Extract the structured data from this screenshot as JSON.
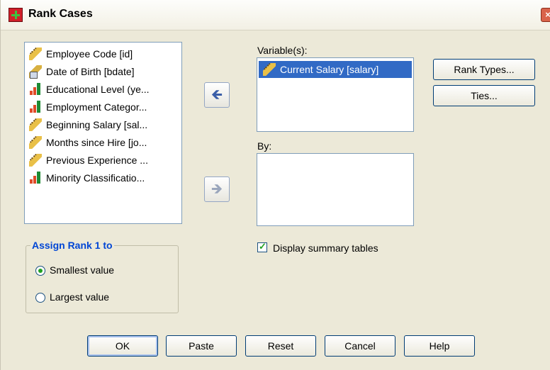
{
  "window": {
    "title": "Rank Cases",
    "close_glyph": "×"
  },
  "source_list": {
    "items": [
      {
        "label": "Employee Code [id]",
        "icon": "ruler-icon"
      },
      {
        "label": "Date of Birth [bdate]",
        "icon": "date-icon"
      },
      {
        "label": "Educational Level (ye...",
        "icon": "bar-chart-icon"
      },
      {
        "label": "Employment Categor...",
        "icon": "bar-chart-icon"
      },
      {
        "label": "Beginning Salary [sal...",
        "icon": "ruler-icon"
      },
      {
        "label": "Months since Hire [jo...",
        "icon": "ruler-icon"
      },
      {
        "label": "Previous Experience ...",
        "icon": "ruler-icon"
      },
      {
        "label": "Minority Classificatio...",
        "icon": "bar-chart-icon"
      }
    ]
  },
  "arrows": {
    "to_variables": "🡸",
    "to_by": "🡺"
  },
  "variables": {
    "label": "Variable(s):",
    "items": [
      {
        "label": "Current Salary [salary]",
        "icon": "ruler-icon",
        "selected": true
      }
    ]
  },
  "by": {
    "label": "By:",
    "items": []
  },
  "buttons": {
    "rank_types": "Rank Types...",
    "ties": "Ties...",
    "ok": "OK",
    "paste": "Paste",
    "reset": "Reset",
    "cancel": "Cancel",
    "help": "Help"
  },
  "assign_rank": {
    "title": "Assign Rank 1 to",
    "options": [
      {
        "label": "Smallest value",
        "selected": true
      },
      {
        "label": "Largest value",
        "selected": false
      }
    ]
  },
  "display_summary": {
    "label": "Display summary tables",
    "checked": true
  },
  "colors": {
    "accent": "#0046d5",
    "selection": "#316ac5",
    "window_bg": "#ece9d8"
  }
}
